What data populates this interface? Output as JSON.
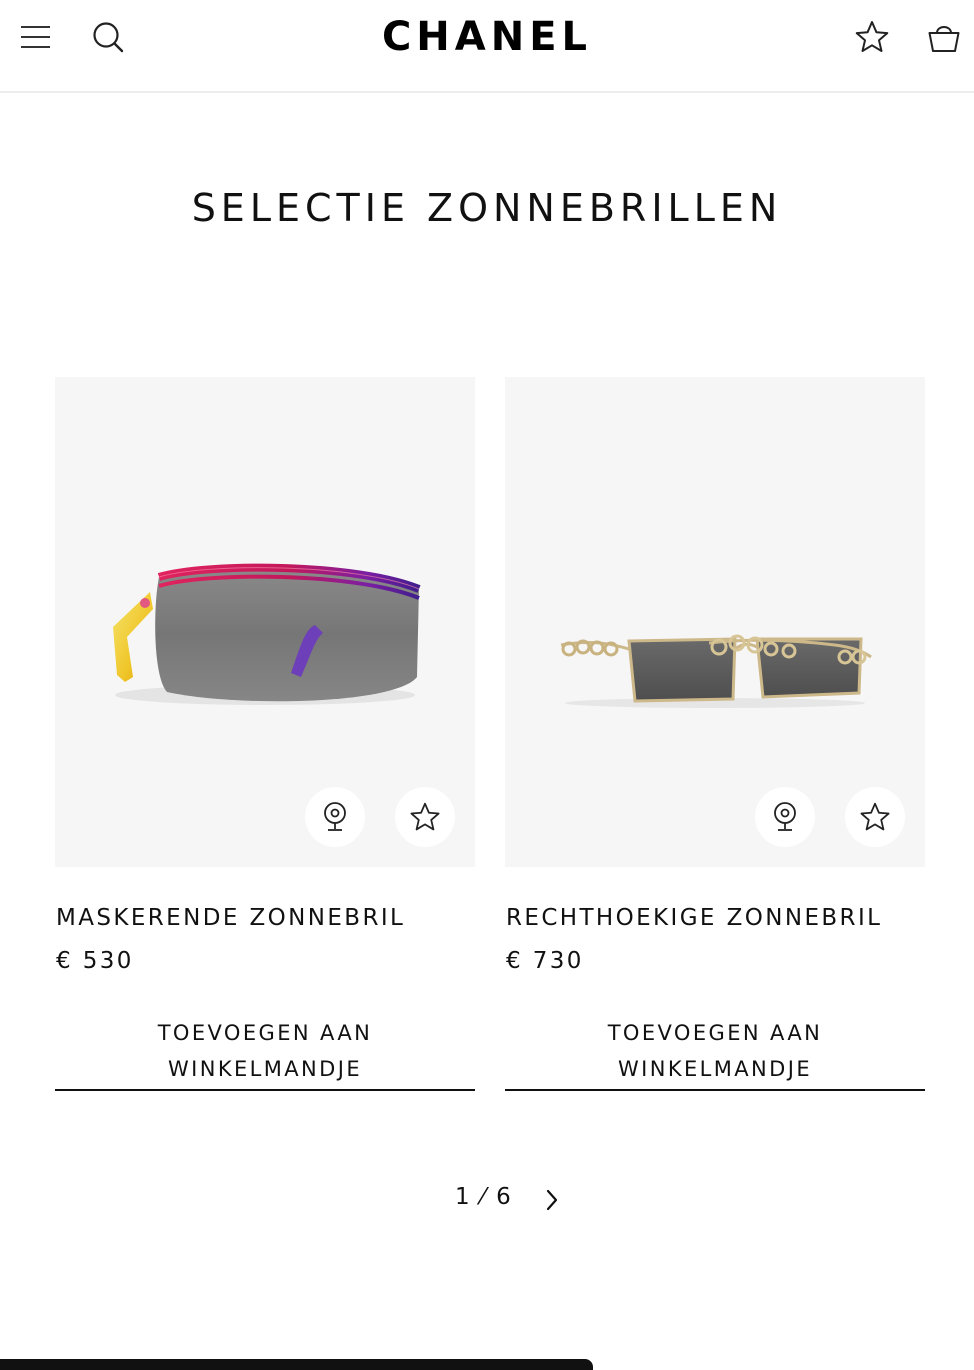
{
  "header": {
    "brand": "CHANEL",
    "menu_icon": "menu-icon",
    "search_icon": "search-icon",
    "wishlist_icon": "star-icon",
    "bag_icon": "shopping-bag-icon"
  },
  "page": {
    "title": "SELECTIE ZONNEBRILLEN"
  },
  "products": [
    {
      "name": "MASKERENDE ZONNEBRIL",
      "price": "€ 530",
      "add_label_line1": "TOEVOEGEN AAN",
      "add_label_line2": "WINKELMANDJE",
      "tryon_icon": "webcam-icon",
      "wishlist_icon": "star-icon"
    },
    {
      "name": "RECHTHOEKIGE ZONNEBRIL",
      "price": "€ 730",
      "add_label_line1": "TOEVOEGEN AAN",
      "add_label_line2": "WINKELMANDJE",
      "tryon_icon": "webcam-icon",
      "wishlist_icon": "star-icon"
    }
  ],
  "pagination": {
    "label": "1 ⁄ 6",
    "next_icon": "chevron-right-icon"
  },
  "colors": {
    "text": "#111111",
    "image_bg": "#f6f6f6",
    "divider": "#ececec"
  }
}
